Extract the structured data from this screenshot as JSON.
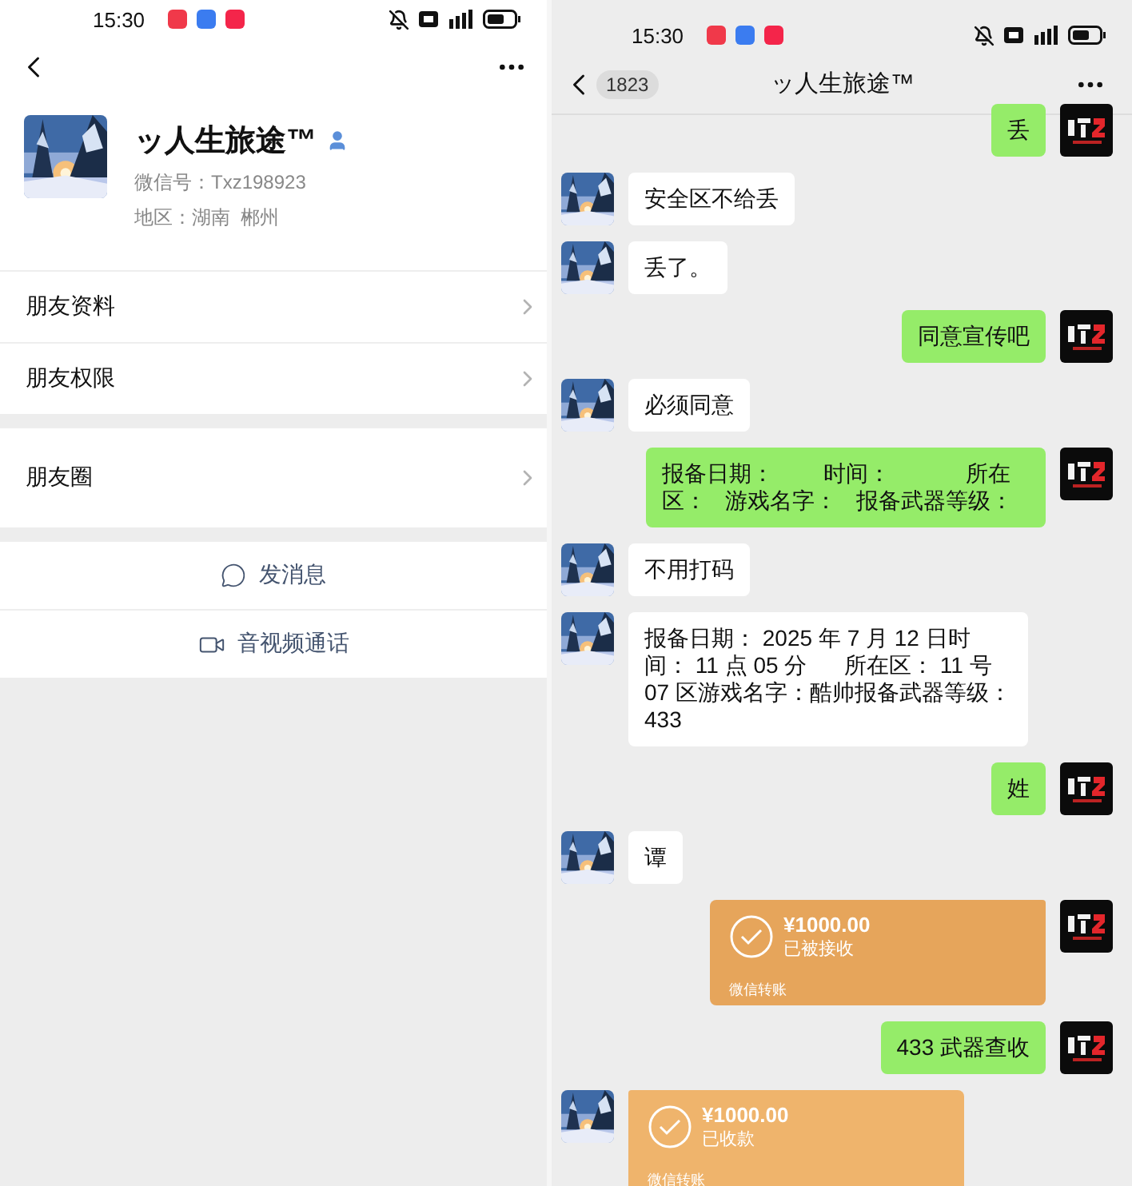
{
  "profile_screen": {
    "status_bar": {
      "time": "15:30"
    },
    "name": "ッ人生旅途™",
    "wechat_id": "微信号：Txz198923",
    "region": "地区：湖南  郴州",
    "menu_groups": [
      [
        {
          "label": "朋友资料"
        },
        {
          "label": "朋友权限"
        }
      ],
      [
        {
          "label": "朋友圈"
        }
      ]
    ],
    "actions": [
      {
        "kind": "message",
        "label": "发消息"
      },
      {
        "kind": "video",
        "label": "音视频通话"
      }
    ]
  },
  "chat_screen": {
    "status_bar": {
      "time": "15:30"
    },
    "unread_count": "1823",
    "title": "ッ人生旅途™",
    "messages": [
      {
        "outgoing": true,
        "kind": "text",
        "text": "丢"
      },
      {
        "outgoing": false,
        "kind": "text",
        "text": "安全区不给丢"
      },
      {
        "outgoing": false,
        "kind": "text",
        "text": "丢了。"
      },
      {
        "outgoing": true,
        "kind": "text",
        "text": "同意宣传吧"
      },
      {
        "outgoing": false,
        "kind": "text",
        "text": "必须同意"
      },
      {
        "outgoing": true,
        "kind": "text",
        "text": "报备日期：        时间：            所在区：   游戏名字：   报备武器等级："
      },
      {
        "outgoing": false,
        "kind": "text",
        "text": "不用打码"
      },
      {
        "outgoing": false,
        "kind": "text",
        "text": "报备日期： 2025 年 7 月 12 日时间： 11 点 05 分      所在区： 11 号 07 区游戏名字：酷帅报备武器等级：433"
      },
      {
        "outgoing": true,
        "kind": "text",
        "text": "姓"
      },
      {
        "outgoing": false,
        "kind": "text",
        "text": "谭"
      },
      {
        "outgoing": true,
        "kind": "transfer",
        "amount": "¥1000.00",
        "status": "已被接收",
        "source": "微信转账"
      },
      {
        "outgoing": true,
        "kind": "text",
        "text": "433 武器查收"
      },
      {
        "outgoing": false,
        "kind": "transfer",
        "amount": "¥1000.00",
        "status": "已收款",
        "source": "微信转账"
      }
    ]
  }
}
